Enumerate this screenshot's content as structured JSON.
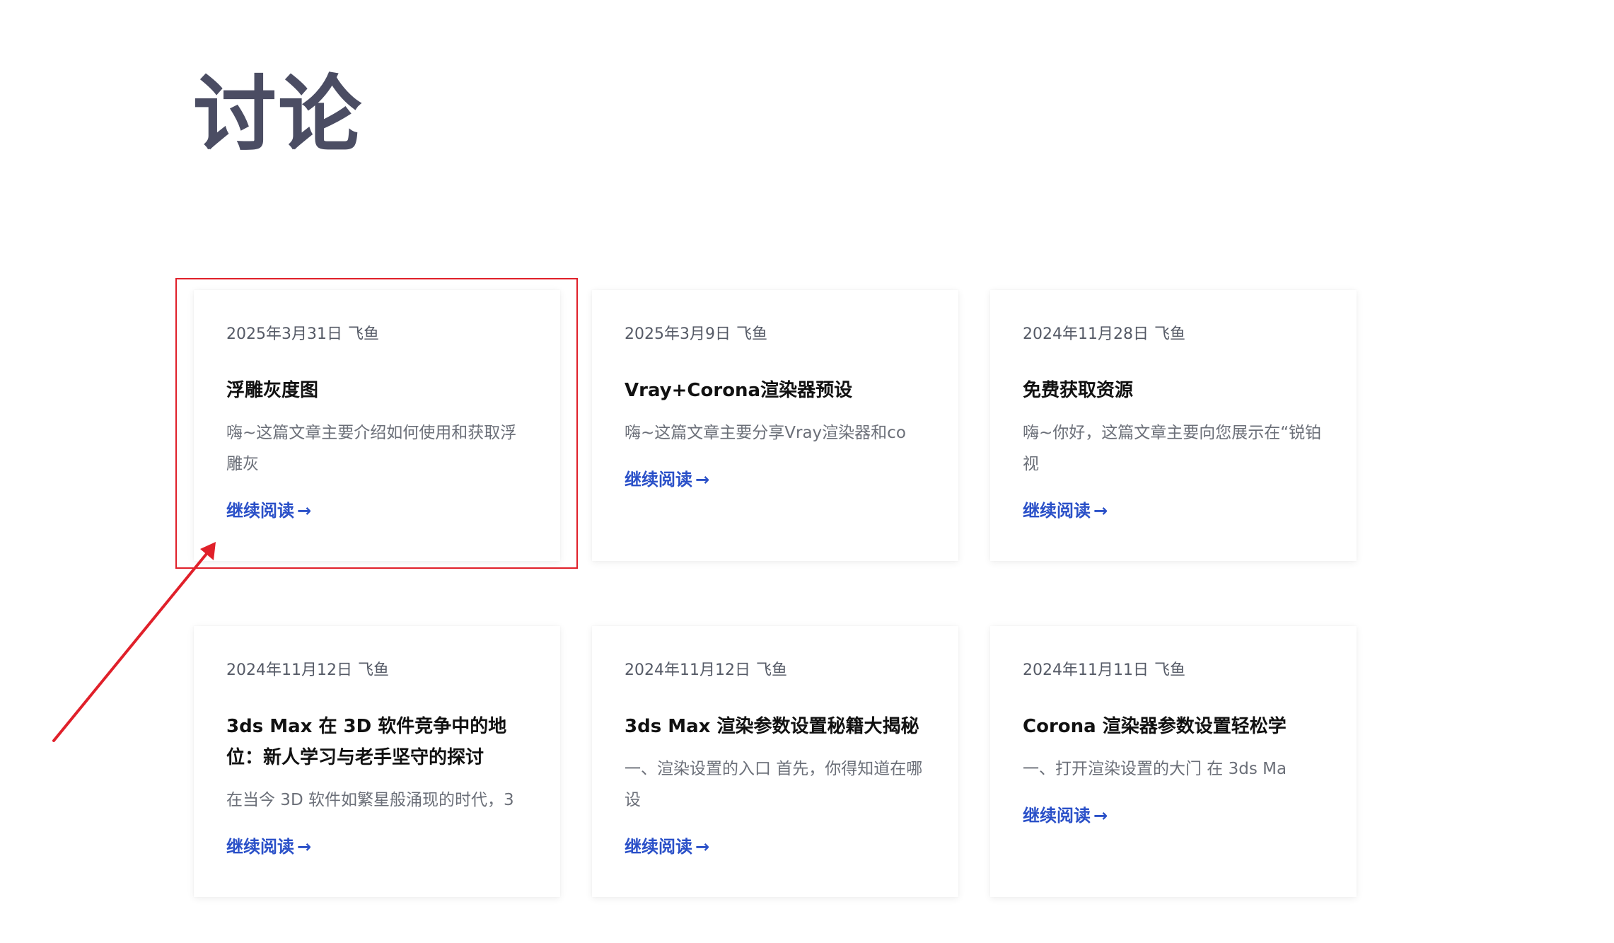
{
  "page": {
    "title": "讨论"
  },
  "cards": [
    {
      "date": "2025年3月31日",
      "author": "飞鱼",
      "title": "浮雕灰度图",
      "excerpt": "嗨~这篇文章主要介绍如何使用和获取浮雕灰",
      "more_label": "继续阅读",
      "more_arrow": "→"
    },
    {
      "date": "2025年3月9日",
      "author": "飞鱼",
      "title": "Vray+Corona渲染器预设",
      "excerpt": "嗨~这篇文章主要分享Vray渲染器和co",
      "more_label": "继续阅读",
      "more_arrow": "→"
    },
    {
      "date": "2024年11月28日",
      "author": "飞鱼",
      "title": "免费获取资源",
      "excerpt": "嗨~你好，这篇文章主要向您展示在“锐铂视",
      "more_label": "继续阅读",
      "more_arrow": "→"
    },
    {
      "date": "2024年11月12日",
      "author": "飞鱼",
      "title": "3ds Max 在 3D 软件竞争中的地位：新人学习与老手坚守的探讨",
      "excerpt": "在当今 3D 软件如繁星般涌现的时代，3",
      "more_label": "继续阅读",
      "more_arrow": "→"
    },
    {
      "date": "2024年11月12日",
      "author": "飞鱼",
      "title": "3ds Max 渲染参数设置秘籍大揭秘",
      "excerpt": "一、渲染设置的入口 首先，你得知道在哪设",
      "more_label": "继续阅读",
      "more_arrow": "→"
    },
    {
      "date": "2024年11月11日",
      "author": "飞鱼",
      "title": "Corona 渲染器参数设置轻松学",
      "excerpt": "一、打开渲染设置的大门 在 3ds Ma",
      "more_label": "继续阅读",
      "more_arrow": "→"
    }
  ],
  "annotation": {
    "color": "#e0202a"
  },
  "colors": {
    "title": "#4b4d63",
    "link": "#2a50c8",
    "meta": "#555a66",
    "excerpt": "#6b6f78"
  }
}
